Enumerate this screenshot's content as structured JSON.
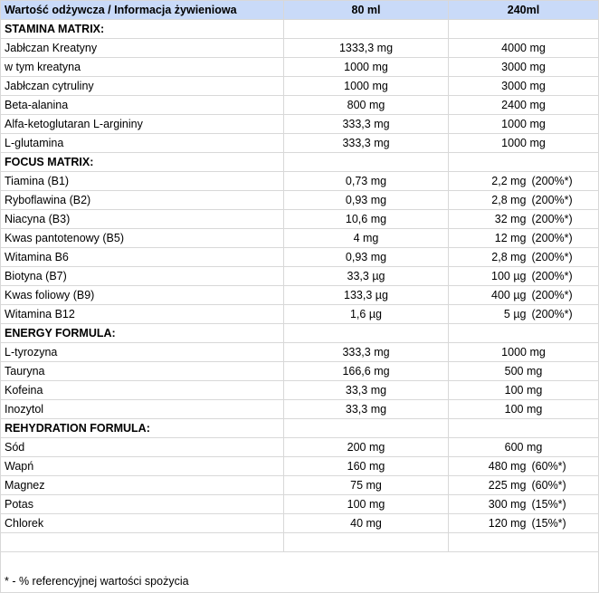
{
  "header": {
    "col1": "Wartość odżywcza / Informacja żywieniowa",
    "col2": "80 ml",
    "col3": "240ml"
  },
  "sections": [
    {
      "title": "STAMINA MATRIX:",
      "rows": [
        {
          "name": "Jabłczan Kreatyny",
          "v80": "1333,3 mg",
          "v240": "4000 mg",
          "pct": ""
        },
        {
          "name": "w tym kreatyna",
          "v80": "1000 mg",
          "v240": "3000 mg",
          "pct": ""
        },
        {
          "name": "Jabłczan cytruliny",
          "v80": "1000 mg",
          "v240": "3000 mg",
          "pct": ""
        },
        {
          "name": "Beta-alanina",
          "v80": "800 mg",
          "v240": "2400 mg",
          "pct": ""
        },
        {
          "name": "Alfa-ketoglutaran L-argininy",
          "v80": "333,3 mg",
          "v240": "1000 mg",
          "pct": ""
        },
        {
          "name": "L-glutamina",
          "v80": "333,3 mg",
          "v240": "1000 mg",
          "pct": ""
        }
      ]
    },
    {
      "title": "FOCUS MATRIX:",
      "rows": [
        {
          "name": "Tiamina (B1)",
          "v80": "0,73 mg",
          "v240": "2,2 mg",
          "pct": "(200%*)"
        },
        {
          "name": "Ryboflawina (B2)",
          "v80": "0,93 mg",
          "v240": "2,8 mg",
          "pct": "(200%*)"
        },
        {
          "name": "Niacyna (B3)",
          "v80": "10,6 mg",
          "v240": "32 mg",
          "pct": "(200%*)"
        },
        {
          "name": "Kwas pantotenowy (B5)",
          "v80": "4 mg",
          "v240": "12 mg",
          "pct": "(200%*)"
        },
        {
          "name": "Witamina B6",
          "v80": "0,93 mg",
          "v240": "2,8 mg",
          "pct": "(200%*)"
        },
        {
          "name": "Biotyna (B7)",
          "v80": "33,3 µg",
          "v240": "100 µg",
          "pct": "(200%*)"
        },
        {
          "name": "Kwas foliowy (B9)",
          "v80": "133,3 µg",
          "v240": "400 µg",
          "pct": "(200%*)"
        },
        {
          "name": "Witamina B12",
          "v80": "1,6 µg",
          "v240": "5 µg",
          "pct": "(200%*)"
        }
      ]
    },
    {
      "title": "ENERGY FORMULA:",
      "rows": [
        {
          "name": "L-tyrozyna",
          "v80": "333,3 mg",
          "v240": "1000 mg",
          "pct": ""
        },
        {
          "name": "Tauryna",
          "v80": "166,6 mg",
          "v240": "500 mg",
          "pct": ""
        },
        {
          "name": "Kofeina",
          "v80": "33,3 mg",
          "v240": "100 mg",
          "pct": ""
        },
        {
          "name": "Inozytol",
          "v80": "33,3 mg",
          "v240": "100 mg",
          "pct": ""
        }
      ]
    },
    {
      "title": "REHYDRATION FORMULA:",
      "rows": [
        {
          "name": "Sód",
          "v80": "200 mg",
          "v240": "600 mg",
          "pct": ""
        },
        {
          "name": "Wapń",
          "v80": "160 mg",
          "v240": "480 mg",
          "pct": "(60%*)"
        },
        {
          "name": "Magnez",
          "v80": "75 mg",
          "v240": "225 mg",
          "pct": "(60%*)"
        },
        {
          "name": "Potas",
          "v80": "100 mg",
          "v240": "300 mg",
          "pct": "(15%*)"
        },
        {
          "name": "Chlorek",
          "v80": "40 mg",
          "v240": "120 mg",
          "pct": "(15%*)"
        }
      ]
    }
  ],
  "footnote": "* - % referencyjnej wartości spożycia",
  "colors": {
    "header_bg": "#c9daf8",
    "grid": "#d8d8d8"
  }
}
